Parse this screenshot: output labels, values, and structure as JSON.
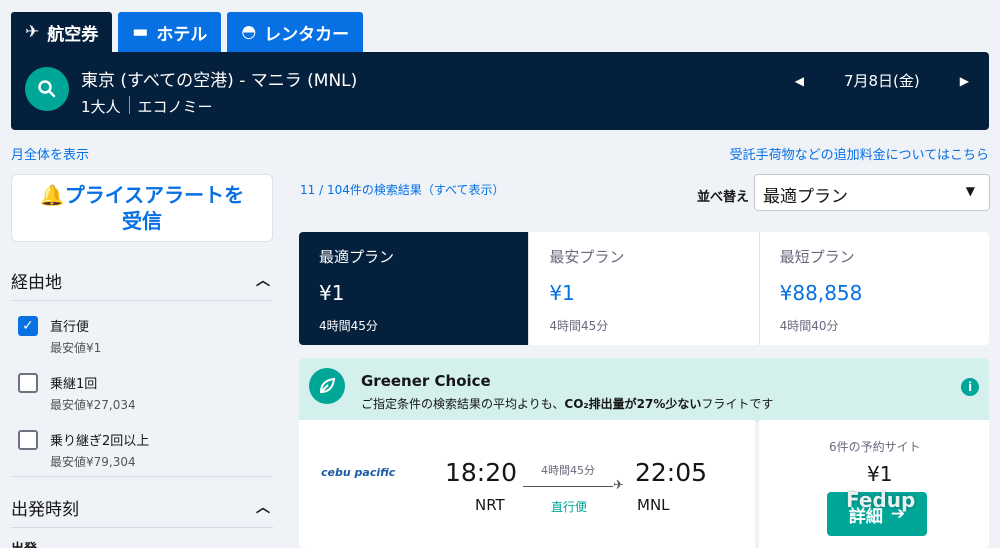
{
  "tabs": [
    {
      "label": "航空券",
      "icon": "plane-icon"
    },
    {
      "label": "ホテル",
      "icon": "bed-icon"
    },
    {
      "label": "レンタカー",
      "icon": "car-icon"
    }
  ],
  "search": {
    "route": "東京 (すべての空港) - マニラ (MNL)",
    "passengers": "1大人",
    "cabin": "エコノミー",
    "date": "7月8日(金)"
  },
  "links": {
    "month_view": "月全体を表示",
    "extra_fees": "受託手荷物などの追加料金についてはこちら"
  },
  "price_alert": {
    "line1": "プライスアラートを",
    "line2": "受信"
  },
  "filters": {
    "stops_title": "経由地",
    "options": [
      {
        "label": "直行便",
        "sub": "最安値¥1",
        "checked": true
      },
      {
        "label": "乗継1回",
        "sub": "最安値¥27,034",
        "checked": false
      },
      {
        "label": "乗り継ぎ2回以上",
        "sub": "最安値¥79,304",
        "checked": false
      }
    ],
    "departure_title": "出発時刻",
    "cut_label": "出発"
  },
  "results": {
    "count_text": "11 / 104件の検索結果（すべて表示）",
    "sort_label": "並べ替え",
    "sort_value": "最適プラン"
  },
  "plans": [
    {
      "title": "最適プラン",
      "price": "¥1",
      "duration": "4時間45分",
      "active": true
    },
    {
      "title": "最安プラン",
      "price": "¥1",
      "duration": "4時間45分",
      "active": false
    },
    {
      "title": "最短プラン",
      "price": "¥88,858",
      "duration": "4時間40分",
      "active": false
    }
  ],
  "greener": {
    "title": "Greener Choice",
    "desc_prefix": "ご指定条件の検索結果の平均よりも、",
    "desc_co2": "CO₂排出量が27%少ない",
    "desc_suffix": "フライトです"
  },
  "flight": {
    "airline": "cebu pacific",
    "dep_time": "18:20",
    "dep_code": "NRT",
    "arr_time": "22:05",
    "arr_code": "MNL",
    "duration": "4時間45分",
    "stops": "直行便"
  },
  "offer": {
    "sites": "6件の予約サイト",
    "price": "¥1",
    "button": "詳細"
  },
  "watermark": "Fedup",
  "colors": {
    "navy": "#05203c",
    "blue": "#0770e3",
    "teal": "#00a698",
    "greener_bg": "#d4f0ec"
  }
}
